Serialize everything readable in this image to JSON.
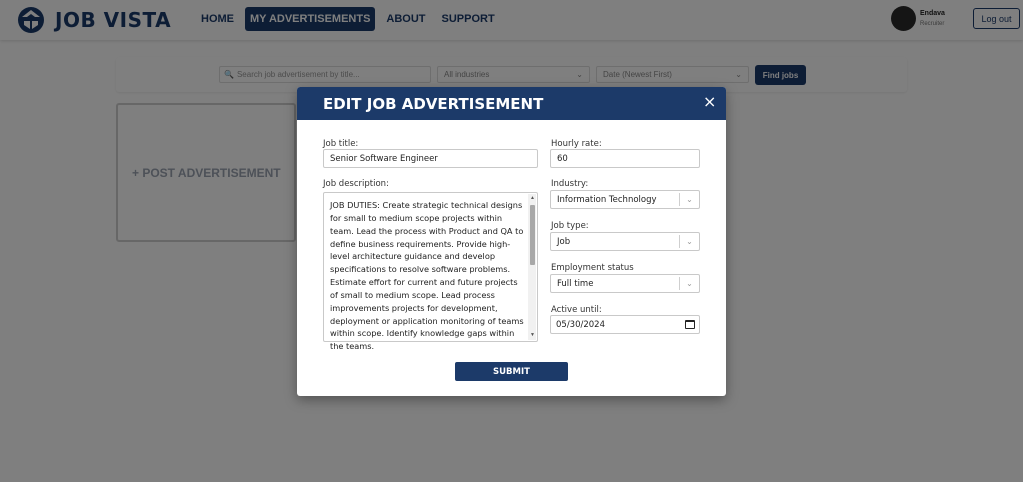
{
  "brand": {
    "name": "JOB VISTA"
  },
  "nav": {
    "items": [
      {
        "label": "HOME"
      },
      {
        "label": "MY ADVERTISEMENTS"
      },
      {
        "label": "ABOUT"
      },
      {
        "label": "SUPPORT"
      }
    ]
  },
  "user": {
    "name": "Endava",
    "role": "Recruiter",
    "logout_label": "Log out"
  },
  "filters": {
    "search_placeholder": "Search job advertisement by title...",
    "industry": "All industries",
    "sort": "Date (Newest First)",
    "find_label": "Find jobs"
  },
  "post_card": {
    "label": "+ POST ADVERTISEMENT"
  },
  "modal": {
    "title": "EDIT JOB ADVERTISEMENT",
    "close_symbol": "×",
    "job_title_label": "Job title:",
    "job_title_value": "Senior Software Engineer",
    "description_label": "Job description:",
    "description_value": "JOB DUTIES: Create strategic technical designs for small to medium scope projects within team. Lead the process with Product and QA to define business requirements. Provide high-level architecture guidance and develop specifications to resolve software problems. Estimate effort for current and future projects of small to medium scope. Lead process improvements projects for development, deployment or application monitoring of teams within scope. Identify knowledge gaps within the teams.",
    "hourly_rate_label": "Hourly rate:",
    "hourly_rate_value": "60",
    "industry_label": "Industry:",
    "industry_value": "Information Technology",
    "job_type_label": "Job type:",
    "job_type_value": "Job",
    "employment_label": "Employment status",
    "employment_value": "Full time",
    "active_until_label": "Active until:",
    "active_until_value": "05/30/2024",
    "submit_label": "SUBMIT"
  },
  "colors": {
    "brand_navy": "#1b3a6b",
    "overlay": "rgba(0,0,0,0.5)"
  }
}
